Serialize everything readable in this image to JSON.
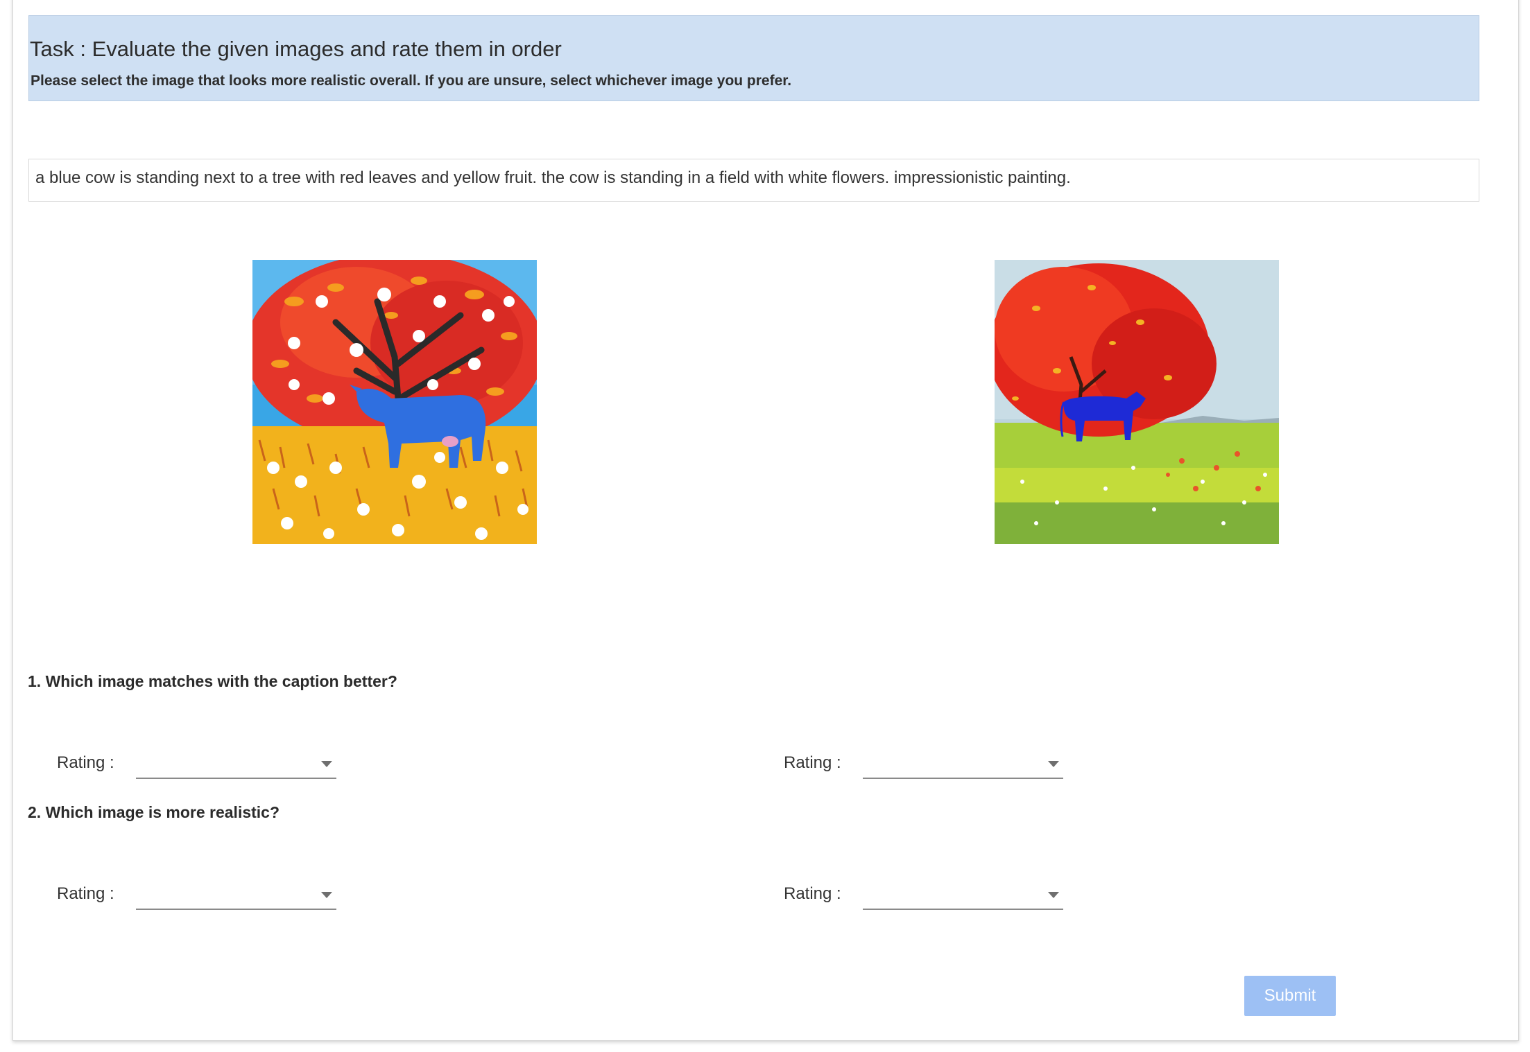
{
  "header": {
    "title": "Task : Evaluate the given images and rate them in order",
    "subtitle": "Please select the image that looks more realistic overall. If you are unsure, select whichever image you prefer."
  },
  "caption": "a blue cow is standing next to a tree with red leaves and yellow fruit. the cow is standing in a field with white flowers. impressionistic painting.",
  "questions": [
    {
      "text": "1. Which image matches with the caption better?",
      "ratings": [
        {
          "label": "Rating :",
          "value": ""
        },
        {
          "label": "Rating :",
          "value": ""
        }
      ]
    },
    {
      "text": "2. Which image is more realistic?",
      "ratings": [
        {
          "label": "Rating :",
          "value": ""
        },
        {
          "label": "Rating :",
          "value": ""
        }
      ]
    }
  ],
  "submit_label": "Submit",
  "colors": {
    "header_bg": "#cfe0f3",
    "submit_bg": "#9dc0f4"
  }
}
